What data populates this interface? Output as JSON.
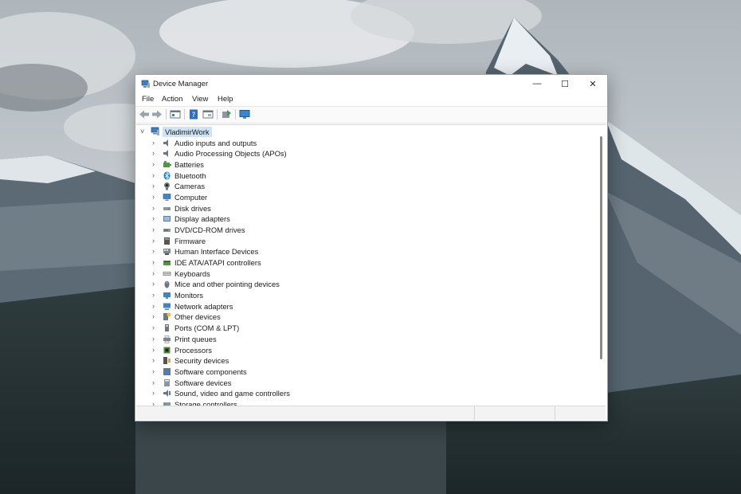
{
  "window": {
    "title": "Device Manager",
    "minimize_glyph": "—",
    "maximize_glyph": "☐",
    "close_glyph": "✕"
  },
  "menu": [
    "File",
    "Action",
    "View",
    "Help"
  ],
  "toolbar_icons": [
    "back-arrow-icon",
    "forward-arrow-icon",
    "properties-view-icon",
    "help-icon",
    "show-hidden-icon",
    "update-driver-icon",
    "scan-hardware-icon"
  ],
  "tree": {
    "root": "VladimirWork",
    "expand_glyph": "›",
    "collapse_glyph": "˅",
    "items": [
      {
        "label": "Audio inputs and outputs",
        "icon": "speaker-icon"
      },
      {
        "label": "Audio Processing Objects (APOs)",
        "icon": "speaker-icon"
      },
      {
        "label": "Batteries",
        "icon": "battery-icon"
      },
      {
        "label": "Bluetooth",
        "icon": "bluetooth-icon"
      },
      {
        "label": "Cameras",
        "icon": "camera-icon"
      },
      {
        "label": "Computer",
        "icon": "computer-icon"
      },
      {
        "label": "Disk drives",
        "icon": "disk-drive-icon"
      },
      {
        "label": "Display adapters",
        "icon": "display-adapter-icon"
      },
      {
        "label": "DVD/CD-ROM drives",
        "icon": "dvd-drive-icon"
      },
      {
        "label": "Firmware",
        "icon": "firmware-icon"
      },
      {
        "label": "Human Interface Devices",
        "icon": "hid-icon"
      },
      {
        "label": "IDE ATA/ATAPI controllers",
        "icon": "ide-controller-icon"
      },
      {
        "label": "Keyboards",
        "icon": "keyboard-icon"
      },
      {
        "label": "Mice and other pointing devices",
        "icon": "mouse-icon"
      },
      {
        "label": "Monitors",
        "icon": "monitor-icon"
      },
      {
        "label": "Network adapters",
        "icon": "network-adapter-icon"
      },
      {
        "label": "Other devices",
        "icon": "unknown-device-icon"
      },
      {
        "label": "Ports (COM & LPT)",
        "icon": "port-icon"
      },
      {
        "label": "Print queues",
        "icon": "printer-icon"
      },
      {
        "label": "Processors",
        "icon": "processor-icon"
      },
      {
        "label": "Security devices",
        "icon": "security-device-icon"
      },
      {
        "label": "Software components",
        "icon": "software-component-icon"
      },
      {
        "label": "Software devices",
        "icon": "software-device-icon"
      },
      {
        "label": "Sound, video and game controllers",
        "icon": "sound-controller-icon"
      },
      {
        "label": "Storage controllers",
        "icon": "storage-controller-icon"
      }
    ]
  },
  "colors": {
    "selection": "#cce4f7",
    "window_border": "#9aa7b2",
    "icon_blue": "#2f7fd0"
  }
}
